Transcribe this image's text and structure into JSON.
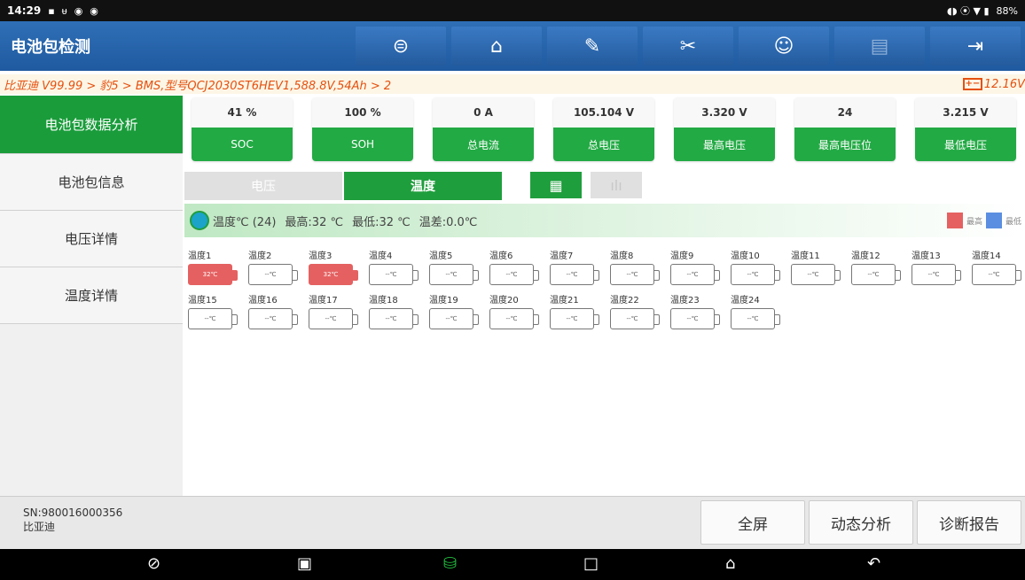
{
  "statusbar": {
    "time": "14:29",
    "left_icons": [
      "▪",
      "ᵾ",
      "◉",
      "◉"
    ],
    "right_icons": "◖◗ ⦿ ▼ ▮",
    "battery": "88%"
  },
  "header": {
    "title": "电池包检测",
    "tools": [
      {
        "icon": "steering-wheel-icon",
        "glyph": "⊜"
      },
      {
        "icon": "home-icon",
        "glyph": "⌂"
      },
      {
        "icon": "edit-icon",
        "glyph": "✎"
      },
      {
        "icon": "tools-icon",
        "glyph": "✂"
      },
      {
        "icon": "support-icon",
        "glyph": "☺"
      },
      {
        "icon": "print-icon",
        "glyph": "▤"
      },
      {
        "icon": "exit-icon",
        "glyph": "⇥"
      }
    ]
  },
  "breadcrumb": {
    "path": "比亚迪 V99.99 > 豹5 > BMS,型号QCJ2030ST6HEV1,588.8V,54Ah > 2",
    "battery_icon": "+−",
    "voltage": "12.16V"
  },
  "sidebar": {
    "items": [
      {
        "label": "电池包数据分析"
      },
      {
        "label": "电池包信息"
      },
      {
        "label": "电压详情"
      },
      {
        "label": "温度详情"
      }
    ]
  },
  "metrics": [
    {
      "value": "41 %",
      "label": "SOC"
    },
    {
      "value": "100 %",
      "label": "SOH"
    },
    {
      "value": "0 A",
      "label": "总电流"
    },
    {
      "value": "105.104 V",
      "label": "总电压"
    },
    {
      "value": "3.320 V",
      "label": "最高电压"
    },
    {
      "value": "24",
      "label": "最高电压位"
    },
    {
      "value": "3.215 V",
      "label": "最低电压"
    }
  ],
  "tabs": {
    "voltage": "电压",
    "temperature": "温度",
    "grid_view_glyph": "▦",
    "chart_view_glyph": "ılı"
  },
  "summary": {
    "count": "温度℃ (24)",
    "max": "最高:32 ℃",
    "min": "最低:32 ℃",
    "diff": "温差:0.0℃",
    "legend_max": "最高",
    "legend_min": "最低",
    "color_max": "#e56161",
    "color_min": "#5b8ee0"
  },
  "temperatures": [
    {
      "name": "温度1",
      "value": "32℃",
      "hot": true
    },
    {
      "name": "温度2",
      "value": "--℃",
      "hot": false
    },
    {
      "name": "温度3",
      "value": "32℃",
      "hot": true
    },
    {
      "name": "温度4",
      "value": "--℃",
      "hot": false
    },
    {
      "name": "温度5",
      "value": "--℃",
      "hot": false
    },
    {
      "name": "温度6",
      "value": "--℃",
      "hot": false
    },
    {
      "name": "温度7",
      "value": "--℃",
      "hot": false
    },
    {
      "name": "温度8",
      "value": "--℃",
      "hot": false
    },
    {
      "name": "温度9",
      "value": "--℃",
      "hot": false
    },
    {
      "name": "温度10",
      "value": "--℃",
      "hot": false
    },
    {
      "name": "温度11",
      "value": "--℃",
      "hot": false
    },
    {
      "name": "温度12",
      "value": "--℃",
      "hot": false
    },
    {
      "name": "温度13",
      "value": "--℃",
      "hot": false
    },
    {
      "name": "温度14",
      "value": "--℃",
      "hot": false
    },
    {
      "name": "温度15",
      "value": "--℃",
      "hot": false
    },
    {
      "name": "温度16",
      "value": "--℃",
      "hot": false
    },
    {
      "name": "温度17",
      "value": "--℃",
      "hot": false
    },
    {
      "name": "温度18",
      "value": "--℃",
      "hot": false
    },
    {
      "name": "温度19",
      "value": "--℃",
      "hot": false
    },
    {
      "name": "温度20",
      "value": "--℃",
      "hot": false
    },
    {
      "name": "温度21",
      "value": "--℃",
      "hot": false
    },
    {
      "name": "温度22",
      "value": "--℃",
      "hot": false
    },
    {
      "name": "温度23",
      "value": "--℃",
      "hot": false
    },
    {
      "name": "温度24",
      "value": "--℃",
      "hot": false
    }
  ],
  "footer": {
    "sn": "SN:980016000356",
    "brand": "比亚迪",
    "buttons": {
      "fullscreen": "全屏",
      "dynamic": "动态分析",
      "report": "诊断报告"
    }
  },
  "navbar": {
    "search_glyph": "⊘",
    "gallery_glyph": "▣",
    "diag_glyph": "⛁",
    "recent_glyph": "□",
    "home_glyph": "⌂",
    "back_glyph": "↶"
  }
}
